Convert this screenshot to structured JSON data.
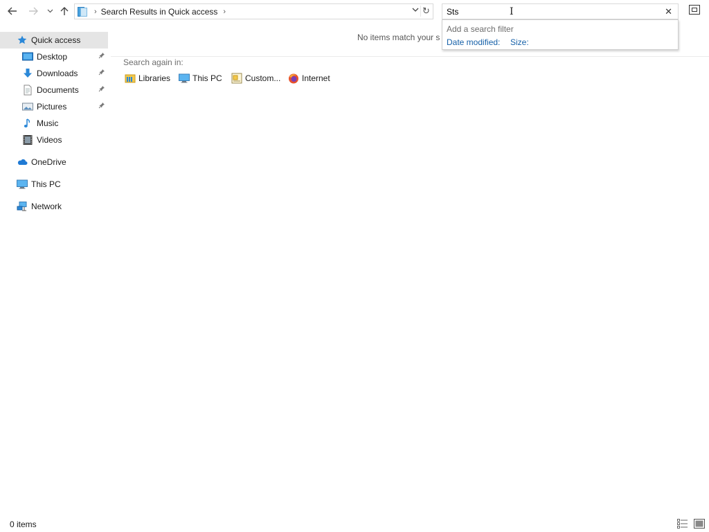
{
  "address": {
    "breadcrumb": "Search Results in Quick access"
  },
  "search": {
    "value": "Sts",
    "clear_symbol": "✕"
  },
  "filter_popup": {
    "title": "Add a search filter",
    "options": [
      "Date modified:",
      "Size:"
    ]
  },
  "nav": {
    "quick_access": "Quick access",
    "items": [
      {
        "label": "Desktop",
        "pinned": true
      },
      {
        "label": "Downloads",
        "pinned": true
      },
      {
        "label": "Documents",
        "pinned": true
      },
      {
        "label": "Pictures",
        "pinned": true
      },
      {
        "label": "Music",
        "pinned": false
      },
      {
        "label": "Videos",
        "pinned": false
      }
    ],
    "onedrive": "OneDrive",
    "this_pc": "This PC",
    "network": "Network"
  },
  "content": {
    "empty_message": "No items match your s",
    "search_again_label": "Search again in:",
    "search_again_items": [
      "Libraries",
      "This PC",
      "Custom...",
      "Internet"
    ]
  },
  "status": {
    "item_count": "0 items"
  },
  "colors": {
    "accent": "#1560a8",
    "selection": "#cce8ff",
    "folder": "#f2c84b",
    "drive_blue": "#2b88d8"
  }
}
